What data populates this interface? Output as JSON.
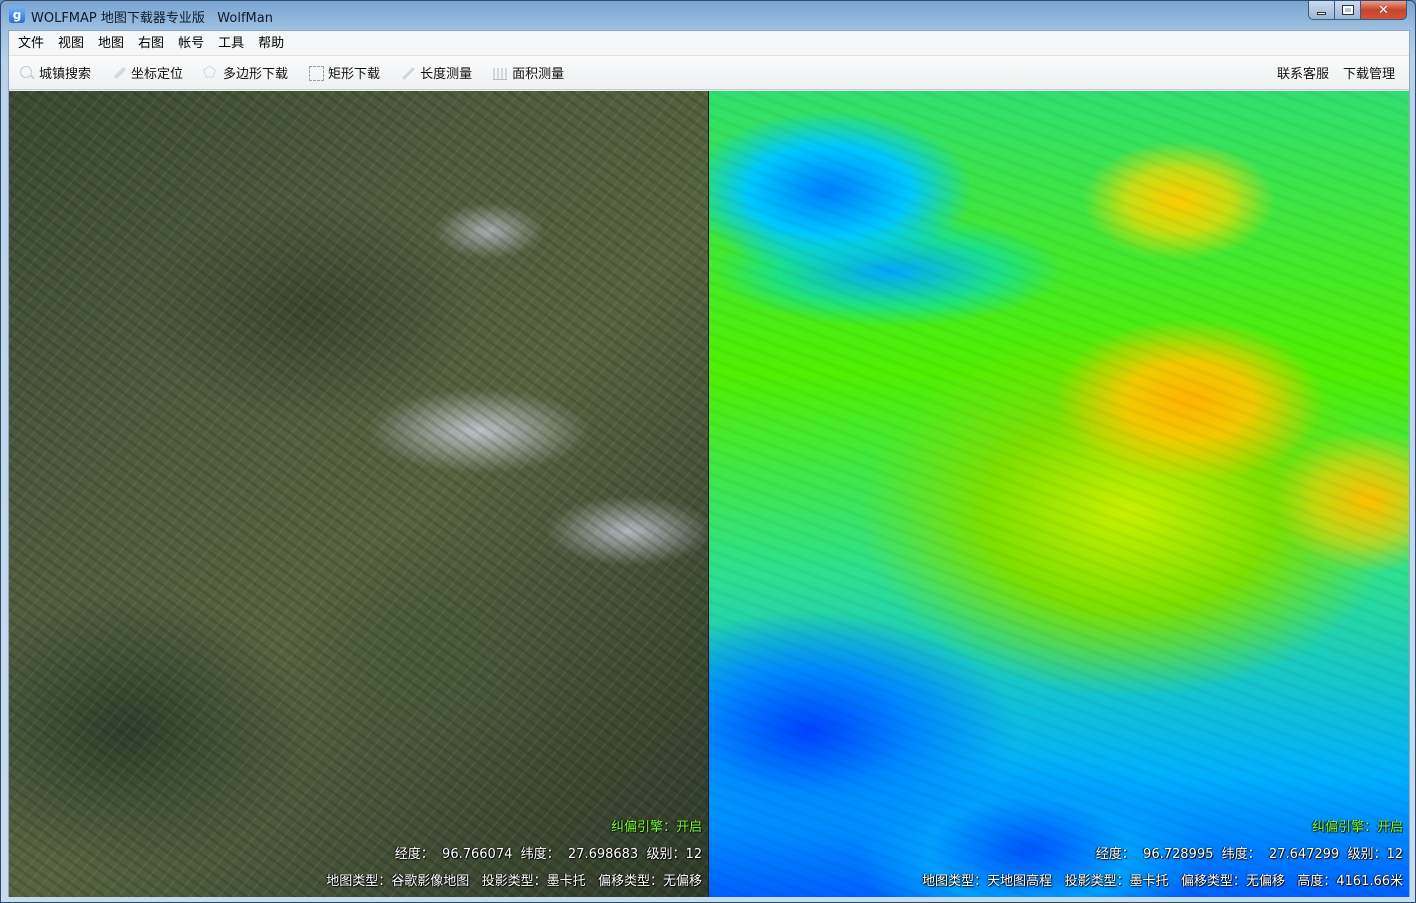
{
  "window": {
    "title": "WOLFMAP 地图下载器专业版   WolfMan",
    "app_icon_letter": "g",
    "min_label": "",
    "max_label": "",
    "close_label": "✕"
  },
  "menu": [
    "文件",
    "视图",
    "地图",
    "右图",
    "帐号",
    "工具",
    "帮助"
  ],
  "toolbar": {
    "tools": [
      {
        "label": "城镇搜索",
        "icon": "search-icon"
      },
      {
        "label": "坐标定位",
        "icon": "pin-icon"
      },
      {
        "label": "多边形下载",
        "icon": "polygon-icon"
      },
      {
        "label": "矩形下载",
        "icon": "rectangle-icon"
      },
      {
        "label": "长度测量",
        "icon": "ruler-icon"
      },
      {
        "label": "面积测量",
        "icon": "area-icon"
      }
    ],
    "right": [
      "联系客服",
      "下载管理"
    ]
  },
  "left_map": {
    "engine": "纠偏引擎：开启",
    "coords": "经度：  96.766074  纬度：  27.698683  级别：12",
    "type_line": "地图类型：谷歌影像地图   投影类型：墨卡托   偏移类型：无偏移"
  },
  "right_map": {
    "engine": "纠偏引擎：开启",
    "coords": "经度：  96.728995  纬度：  27.647299  级别：12",
    "type_line": "地图类型：天地图高程   投影类型：墨卡托   偏移类型：无偏移   高度：4161.66米"
  },
  "colors": {
    "engine_text": "#7cff3a",
    "titlebar": "#7aa4cf"
  }
}
